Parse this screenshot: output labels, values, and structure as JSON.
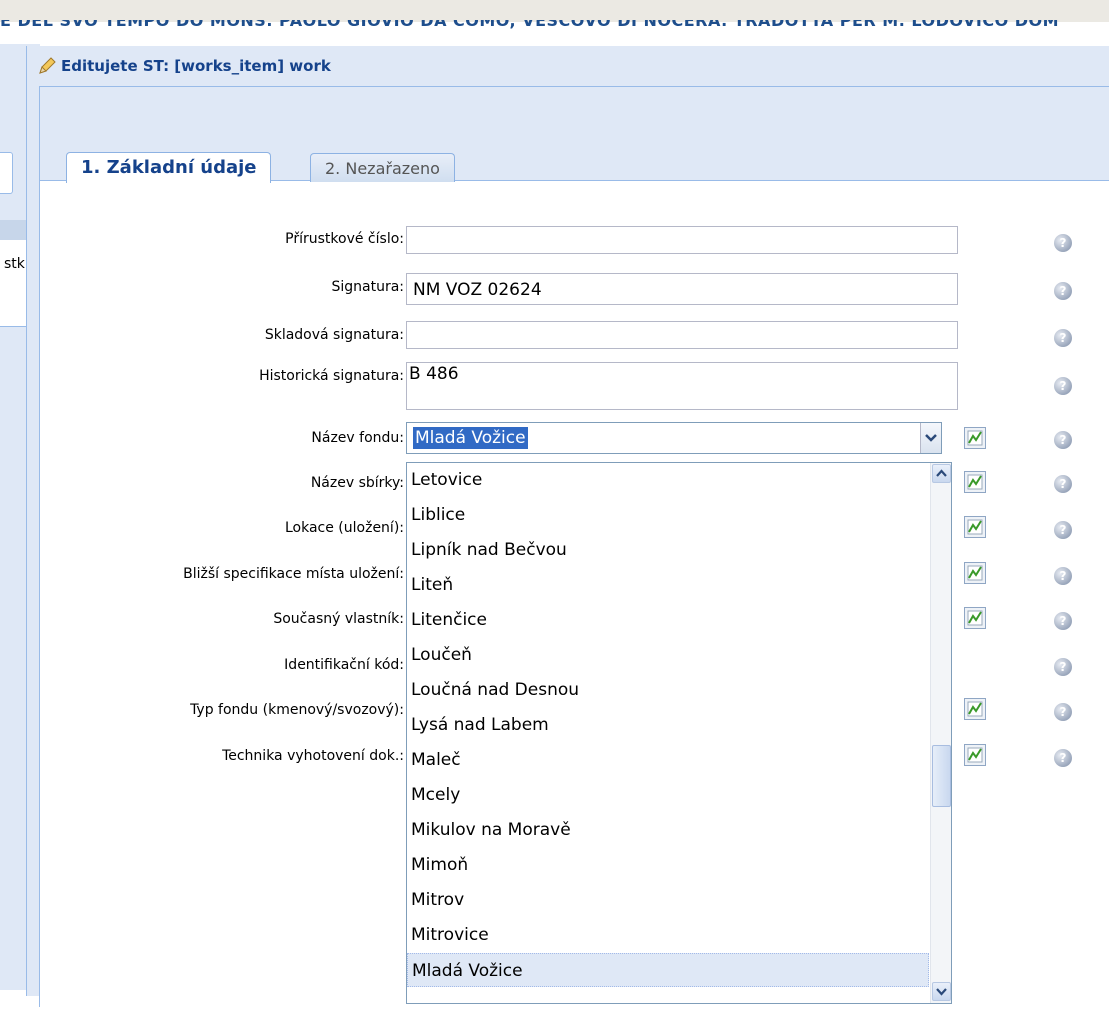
{
  "background_header": "E DEL SVO TEMPO DO MONS. PAOLO GIOVIO DA COMO, VESCOVO DI NOCERA. TRADOTTA PER M. LODOVICO DOM",
  "left_panel_fragment": "stk",
  "window": {
    "title": "Editujete ST: [works_item] work"
  },
  "tabs": [
    {
      "label": "1. Základní údaje",
      "active": true
    },
    {
      "label": "2. Nezařazeno",
      "active": false
    }
  ],
  "fields": {
    "prirustkove_cislo": {
      "label": "Přírustkové číslo:",
      "value": ""
    },
    "signatura": {
      "label": "Signatura:",
      "value": "NM VOZ 02624"
    },
    "skladova_signatura": {
      "label": "Skladová signatura:",
      "value": ""
    },
    "historicka_signatura": {
      "label": "Historická signatura:",
      "value": "B 486"
    },
    "nazev_fondu": {
      "label": "Název fondu:",
      "value": "Mladá Vožice"
    },
    "nazev_sbirky": {
      "label": "Název sbírky:"
    },
    "lokace": {
      "label": "Lokace (uložení):"
    },
    "blizsi_specifikace": {
      "label": "Bližší specifikace místa uložení:"
    },
    "soucasny_vlastnik": {
      "label": "Současný vlastník:"
    },
    "identifikacni_kod": {
      "label": "Identifikační kód:"
    },
    "typ_fondu": {
      "label": "Typ fondu (kmenový/svozový):"
    },
    "technika": {
      "label": "Technika vyhotovení dok.:"
    }
  },
  "dropdown": {
    "options": [
      "Letovice",
      "Liblice",
      "Lipník nad Bečvou",
      "Liteň",
      "Litenčice",
      "Loučeň",
      "Loučná nad Desnou",
      "Lysá nad Labem",
      "Maleč",
      "Mcely",
      "Mikulov na Moravě",
      "Mimoň",
      "Mitrov",
      "Mitrovice",
      "Mladá Vožice"
    ],
    "selected": "Mladá Vožice"
  },
  "icons": {
    "help": "help-icon",
    "edit": "pencil-icon",
    "lookup": "chart-lookup-icon"
  },
  "colors": {
    "title": "#15428b",
    "panel_bg": "#dfe8f6",
    "selection": "#316ac5"
  }
}
